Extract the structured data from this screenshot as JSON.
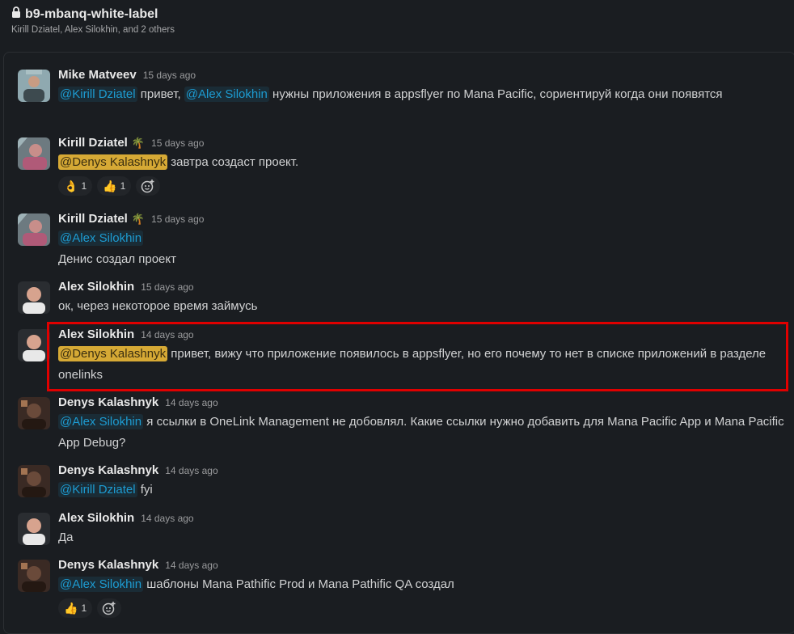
{
  "channel": {
    "name": "b9-mbanq-white-label",
    "members": "Kirill Dziatel, Alex Silokhin, and 2 others"
  },
  "messages": [
    {
      "author": "Mike Matveev",
      "time": "15 days ago",
      "mention1": "@Kirill Dziatel",
      "text1": " привет, ",
      "mention2": "@Alex Silokhin",
      "text2": " нужны приложения в appsflyer по Mana Pacific, сориентируй когда они появятся"
    },
    {
      "author": "Kirill Dziatel",
      "status_emoji": "🌴",
      "time": "15 days ago",
      "mention1": "@Denys Kalashnyk",
      "text1": " завтра создаст проект.",
      "reactions": [
        {
          "emoji": "👌",
          "count": "1"
        },
        {
          "emoji": "👍",
          "count": "1"
        }
      ]
    },
    {
      "author": "Kirill Dziatel",
      "status_emoji": "🌴",
      "time": "15 days ago",
      "mention1": "@Alex Silokhin",
      "line2": "Денис создал проект"
    },
    {
      "author": "Alex Silokhin",
      "time": "15 days ago",
      "text1": "ок, через некоторое время займусь"
    },
    {
      "author": "Alex Silokhin",
      "time": "14 days ago",
      "mention1": "@Denys Kalashnyk",
      "text1": " привет, вижу что приложение появилось в appsflyer, но его почему то нет в списке приложений в разделе onelinks"
    },
    {
      "author": "Denys Kalashnyk",
      "time": "14 days ago",
      "mention1": "@Alex Silokhin",
      "text1": " я ссылки в OneLink Management не добовлял. Какие ссылки нужно добавить для Mana Pacific App и Mana Pacific App Debug?"
    },
    {
      "author": "Denys Kalashnyk",
      "time": "14 days ago",
      "mention1": "@Kirill Dziatel",
      "text1": " fyi"
    },
    {
      "author": "Alex Silokhin",
      "time": "14 days ago",
      "text1": "Да"
    },
    {
      "author": "Denys Kalashnyk",
      "time": "14 days ago",
      "mention1": "@Alex Silokhin",
      "text1": " шаблоны Mana Pathific Prod и Mana Pathific QA создал",
      "reactions": [
        {
          "emoji": "👍",
          "count": "1"
        }
      ]
    }
  ],
  "colors": {
    "background": "#1a1d21",
    "mention_text": "#1d9bd1",
    "self_mention_bg": "#d6a935",
    "highlight_border": "#e00000"
  }
}
